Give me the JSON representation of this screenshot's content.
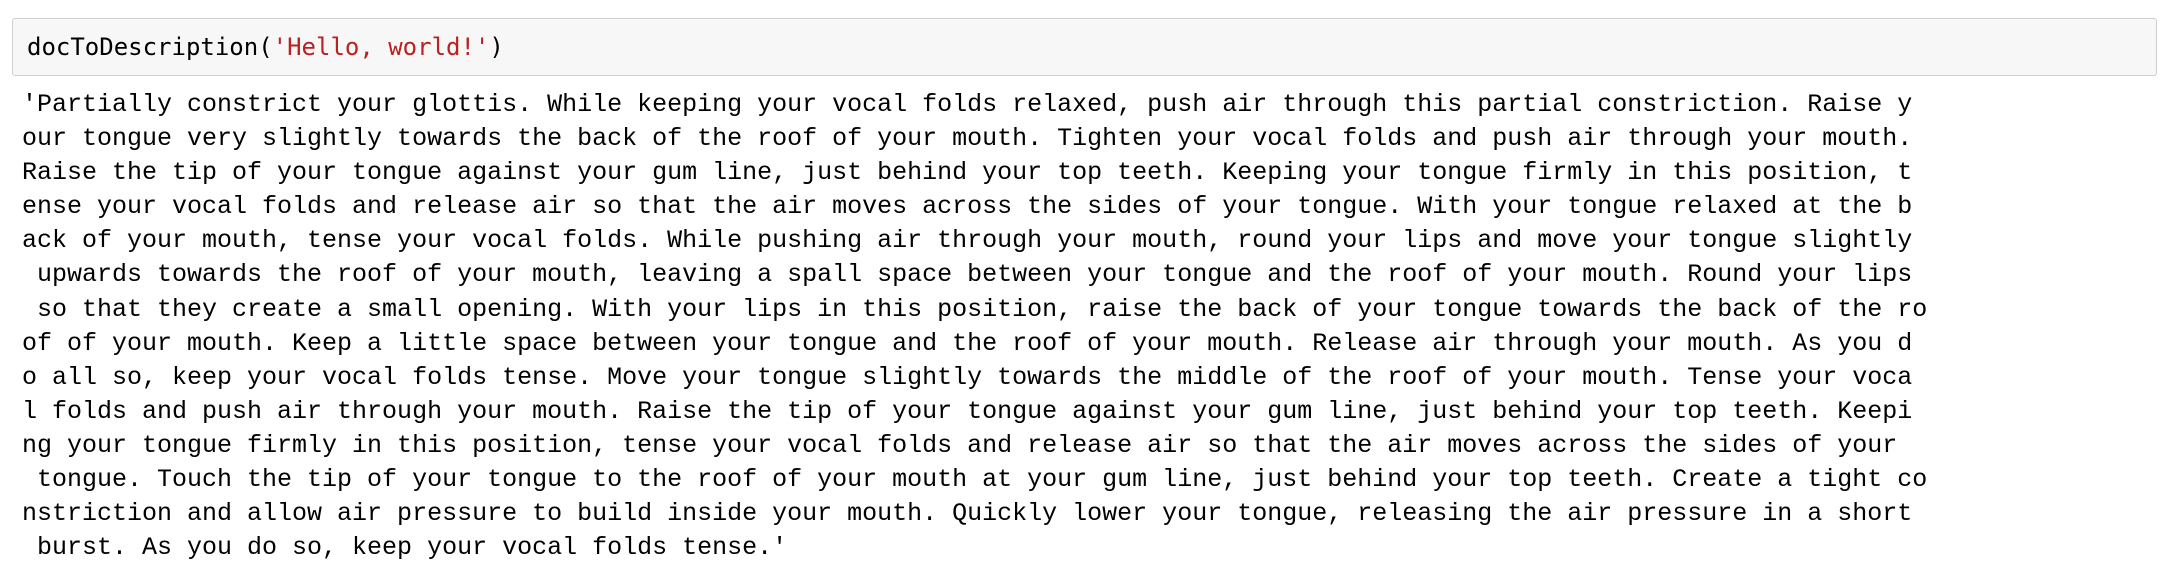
{
  "input_cell": {
    "function_name": "docToDescription",
    "open_paren": "(",
    "argument": "'Hello, world!'",
    "close_paren": ")",
    "string_color": "#ba2121"
  },
  "output_cell": {
    "lines": [
      "'Partially constrict your glottis. While keeping your vocal folds relaxed, push air through this partial constriction. Raise y",
      "our tongue very slightly towards the back of the roof of your mouth. Tighten your vocal folds and push air through your mouth.",
      "Raise the tip of your tongue against your gum line, just behind your top teeth. Keeping your tongue firmly in this position, t",
      "ense your vocal folds and release air so that the air moves across the sides of your tongue. With your tongue relaxed at the b",
      "ack of your mouth, tense your vocal folds. While pushing air through your mouth, round your lips and move your tongue slightly",
      " upwards towards the roof of your mouth, leaving a spall space between your tongue and the roof of your mouth. Round your lips",
      " so that they create a small opening. With your lips in this position, raise the back of your tongue towards the back of the ro",
      "of of your mouth. Keep a little space between your tongue and the roof of your mouth. Release air through your mouth. As you d",
      "o all so, keep your vocal folds tense. Move your tongue slightly towards the middle of the roof of your mouth. Tense your voca",
      "l folds and push air through your mouth. Raise the tip of your tongue against your gum line, just behind your top teeth. Keepi",
      "ng your tongue firmly in this position, tense your vocal folds and release air so that the air moves across the sides of your",
      " tongue. Touch the tip of your tongue to the roof of your mouth at your gum line, just behind your top teeth. Create a tight co",
      "nstriction and allow air pressure to build inside your mouth. Quickly lower your tongue, releasing the air pressure in a short",
      " burst. As you do so, keep your vocal folds tense.'"
    ]
  }
}
